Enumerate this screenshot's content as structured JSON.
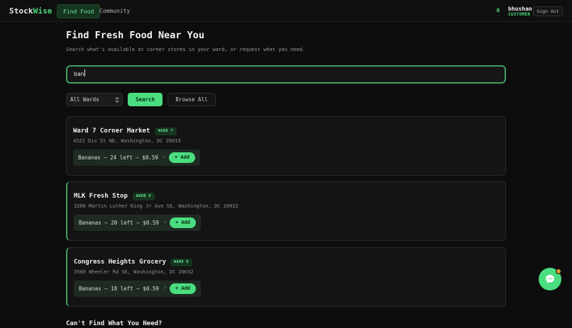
{
  "brand": {
    "part1": "Stock",
    "part2": "Wise"
  },
  "nav": {
    "tabs": [
      {
        "label": "Find Food"
      },
      {
        "label": "Community"
      }
    ]
  },
  "user": {
    "avatar": "B",
    "name": "bhushan",
    "role": "CUSTOMER",
    "signout_label": "Sign Out"
  },
  "header": {
    "title": "Find Fresh Food Near You",
    "subtitle": "Search what's available at corner stores in your ward, or request what you need."
  },
  "search": {
    "value": "ban",
    "ward_select": "All Wards",
    "search_label": "Search",
    "browse_label": "Browse All"
  },
  "stores": [
    {
      "name": "Ward 7 Corner Market",
      "ward": "WARD 7",
      "address": "4521 Dix St NE, Washington, DC 20019",
      "product": "Bananas — 24 left — $0.59",
      "check": "✓",
      "add_label": "+ Add"
    },
    {
      "name": "MLK Fresh Stop",
      "ward": "WARD 8",
      "address": "3200 Martin Luther King Jr Ave SE, Washington, DC 20032",
      "product": "Bananas — 20 left — $0.59",
      "check": "✓",
      "add_label": "+ Add"
    },
    {
      "name": "Congress Heights Grocery",
      "ward": "WARD 8",
      "address": "3500 Wheeler Rd SE, Washington, DC 20032",
      "product": "Bananas — 18 left — $0.59",
      "check": "✓",
      "add_label": "+ Add"
    }
  ],
  "request": {
    "title": "Can't Find What You Need?"
  },
  "colors": {
    "accent": "#4ade80",
    "background": "#0d0d0d",
    "card": "#141414",
    "notification": "#d99a3a"
  },
  "icons": {
    "select": "chevron-up-down-icon",
    "chat": "chat-bubble-icon"
  }
}
